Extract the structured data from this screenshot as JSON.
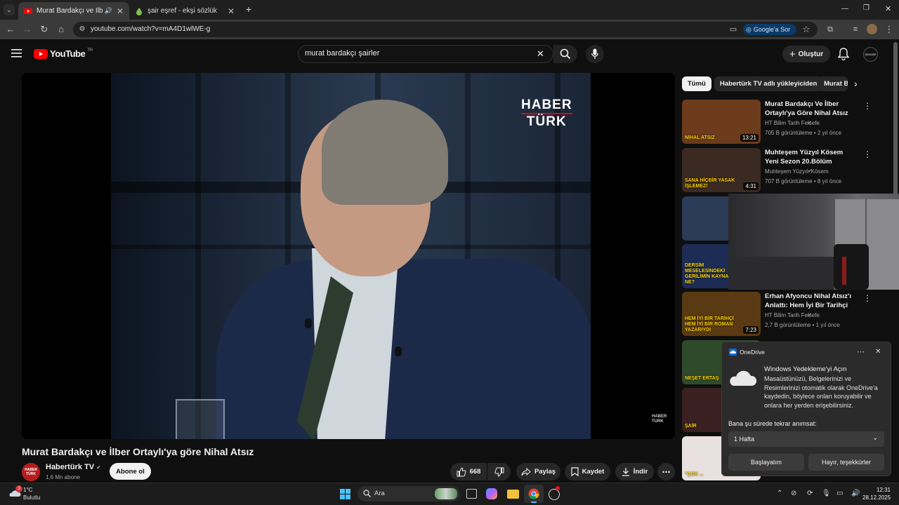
{
  "browser": {
    "tabs": [
      {
        "title": "Murat Bardakçı ve İlber Ortaylı'ya göre Nihal Atsız",
        "active": true
      },
      {
        "title": "şair eşref - ekşi sözlük",
        "active": false
      }
    ],
    "new_tab_label": "+",
    "url": "youtube.com/watch?v=mA4D1wlWE-g",
    "google_button": "Google'a Sor"
  },
  "youtube": {
    "logo_text": "YouTube",
    "region": "TR",
    "search_value": "murat bardakçı şairler",
    "create_label": "Oluştur",
    "avatar_text": "SENLESE"
  },
  "video": {
    "title": "Murat Bardakçı ve İlber Ortaylı'ya göre Nihal Atsız",
    "overlay_logo_line1": "HABER",
    "overlay_logo_line2": "TÜRK",
    "corner_logo_line1": "HABER",
    "corner_logo_line2": "TURK"
  },
  "channel": {
    "name": "Habertürk TV",
    "subscribers": "1,6 Mn abone",
    "avatar_text": "HABER TÜRK",
    "subscribe_label": "Abone ol"
  },
  "actions": {
    "likes": "668",
    "share": "Paylaş",
    "save": "Kaydet",
    "download": "İndir"
  },
  "chips": [
    "Tümü",
    "Habertürk TV adlı yükleyiciden",
    "Murat B"
  ],
  "recommendations": [
    {
      "title": "Murat Bardakçı Ve İlber Ortaylı'ya Göre Nihal Atsız",
      "channel": "HT Bilim Tarih Felsefe",
      "meta": "705 B görüntüleme • 2 yıl önce",
      "duration": "13:21",
      "thumb_caption": "NİHAL ATSIZ",
      "thumb_color": "#6b3b1c"
    },
    {
      "title": "Muhteşem Yüzyıl Kösem Yeni Sezon 20.Bölüm (50.Bölüm) | ...",
      "channel": "Muhteşem Yüzyıl: Kösem",
      "meta": "707 B görüntüleme • 8 yıl önce",
      "duration": "4:31",
      "thumb_caption": "SANA HİÇBİR YASAK İŞLEMEZ!",
      "thumb_color": "#3b2a22"
    },
    {
      "title": "",
      "channel": "",
      "meta": "",
      "duration": "",
      "thumb_caption": "",
      "thumb_color": "#2b3a55"
    },
    {
      "title": "",
      "channel": "",
      "meta": "",
      "duration": "",
      "thumb_caption": "DERSİM MESELESİNDEKİ GERİLİMİN KAYNAĞI NE?",
      "thumb_color": "#1d2c55"
    },
    {
      "title": "Erhan Afyoncu Nihal Atsız'ı Anlattı: Hem İyi Bir Tarihçi He...",
      "channel": "HT Bilim Tarih Felsefe",
      "meta": "2,7 B görüntüleme • 1 yıl önce",
      "duration": "7:23",
      "thumb_caption": "HEM İYİ BİR TARİHÇİ HEM İYİ BİR ROMAN YAZARIYDI",
      "thumb_color": "#5a3a12"
    },
    {
      "title": "",
      "channel": "",
      "meta": "",
      "duration": "",
      "thumb_caption": "NEŞET ERTAŞ",
      "thumb_color": "#2f4a2a"
    },
    {
      "title": "",
      "channel": "",
      "meta": "",
      "duration": "",
      "thumb_caption": "ŞAİR",
      "thumb_color": "#3a2020"
    },
    {
      "title": "",
      "channel": "",
      "meta": "",
      "duration": "",
      "thumb_caption": "\"ÇOK ...",
      "thumb_color": "#e9e0e0"
    }
  ],
  "onedrive": {
    "app_name": "OneDrive",
    "heading": "Windows Yedekleme'yi Açın",
    "body": "Masaüstünüzü, Belgelerinizi ve Resimlerinizi otomatik olarak OneDrive'a kaydedin, böylece onları koruyabilir ve onlara her yerden erişebilirsiniz.",
    "remind_label": "Bana şu sürede tekrar anımsat:",
    "remind_value": "1 Hafta",
    "primary_button": "Başlayalım",
    "secondary_button": "Hayır, teşekkürler"
  },
  "taskbar": {
    "weather_temp": "1°C",
    "weather_desc": "Bulutlu",
    "weather_badge": "3",
    "search_label": "Ara",
    "time": "12:31",
    "date": "28.12.2025"
  },
  "colors": {
    "yt_red": "#ff0000",
    "page_bg": "#0f0f0f",
    "tab_active": "#3a3a3a"
  }
}
